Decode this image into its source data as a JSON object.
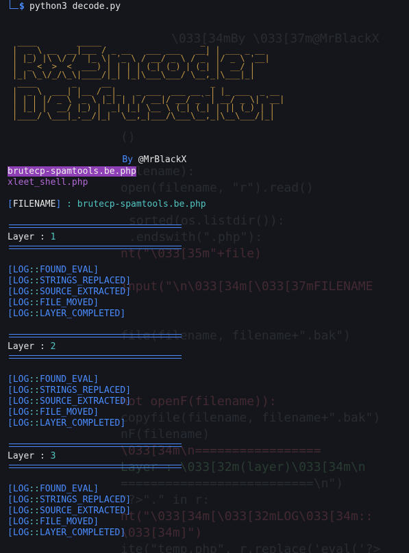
{
  "window": {
    "prompt_symbol": "$",
    "command": "python3 decode.py"
  },
  "banner": {
    "ascii": " ____        _____                    _           \n|  _ \\ __  __|___ / _ __   ___ ___   __| | ___ _ __ \n| |_) |\\ \\/ /  |_ \\| '_ \\ / __/ _ \\ / _` |/ _ \\ '__|\n|  _ <  >  <  ___) | | | | (_| (_) | (_| |  __/ |   \n|_| \\_\\/_/\\_\\|____/|_| |_|\\___\\___/ \\__,_|\\___|_|   \n ____       _     __                    _           \n|  _ \\  ___| |__ / _|_   _ ___  ___ __ _| |_ ___  _ __\n| | | |/ _ \\ '_ \\ |_| | | / __|/ __/ _` | __/ _ \\| '__|\n| |_| |  __/ |_) |  _| |_| \\__ \\ (_| (_| | || (_) | |  \n|____/ \\___|_.__/|_|  \\__,_|___/\\___\\__,_|\\__\\___/|_|  ",
    "by_label": "By",
    "author": "@MrBlackX"
  },
  "files": [
    {
      "name": "brutecp-spamtools.be.php",
      "selected": true
    },
    {
      "name": "xleet_shell.php",
      "selected": false
    }
  ],
  "filename_prompt": {
    "open": "[",
    "label": "FILENAME",
    "close": "]",
    "sep": " : ",
    "value": "brutecp-spamtools.be.php"
  },
  "layer_label": "Layer",
  "layer_sep": " : ",
  "log_tag": "LOG",
  "log_sep": "::",
  "layers": [
    {
      "number": "1",
      "logs": [
        "FOUND_EVAL",
        "STRINGS_REPLACED",
        "SOURCE_EXTRACTED",
        "FILE_MOVED",
        "LAYER_COMPLETED"
      ]
    },
    {
      "number": "2",
      "logs": [
        "FOUND_EVAL",
        "STRINGS_REPLACED",
        "SOURCE_EXTRACTED",
        "FILE_MOVED",
        "LAYER_COMPLETED"
      ]
    },
    {
      "number": "3",
      "logs": [
        "FOUND_EVAL",
        "STRINGS_REPLACED",
        "SOURCE_EXTRACTED",
        "FILE_MOVED",
        "LAYER_COMPLETED"
      ]
    }
  ],
  "background_code": [
    "\\033[34mBy \\033[37m@MrBlackX",
    "()",
    "filename):",
    "open(filename, \"r\").read()",
    "sorted(os.listdir()):",
    ".endswith(\".php\"):",
    "nt(\"\\033[35m\"+file)",
    "input(\"\\n\\033[34m[\\033[37mFILENAME",
    "file(filename, filename+\".bak\")",
    "not openF(filename)):",
    "copyfile(filename, filename+\".bak\")",
    "nF(filename)",
    "\\033[34m\\n=================",
    "Layer : \\033[32m(layer)\\033[34m\\n",
    "==========================\\n\")",
    "\"?>\".\" in r:",
    "nt(\"\\033[34m[\\033[32mLOG\\033[34m::",
    "\\033[34m]\")",
    "ite(\"temp.php\", r.replace('eval('?>"
  ]
}
